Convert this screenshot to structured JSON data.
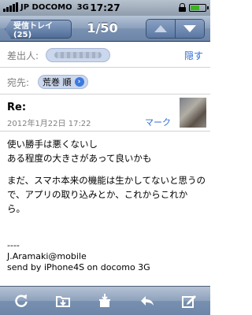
{
  "status_bar": {
    "carrier": "JP DOCOMO",
    "network": "3G",
    "time": "17:27"
  },
  "nav": {
    "back_label": "受信トレイ (25)",
    "title": "1/50"
  },
  "header": {
    "from_label": "差出人:",
    "hide_label": "隠す",
    "to_label": "宛先:",
    "to_name": "荒巻 順",
    "subject": "Re:",
    "date": "2012年1月22日 17:22",
    "mark_label": "マーク"
  },
  "message": {
    "paragraph1": "使い勝手は悪くないし\nある程度の大きさがあって良いかも",
    "paragraph2": "まだ、スマホ本来の機能は生かしてないと思うので、アプリの取り込みとか、これからこれから。",
    "signature": "----\nJ.Aramaki@mobile\nsend by iPhone4S on docomo 3G"
  },
  "toolbar": {
    "items": [
      "refresh-icon",
      "folder-move-icon",
      "trash-icon",
      "reply-icon",
      "compose-icon"
    ]
  },
  "colors": {
    "link": "#2d6fd6",
    "nav_bar": "#7a91b1"
  }
}
